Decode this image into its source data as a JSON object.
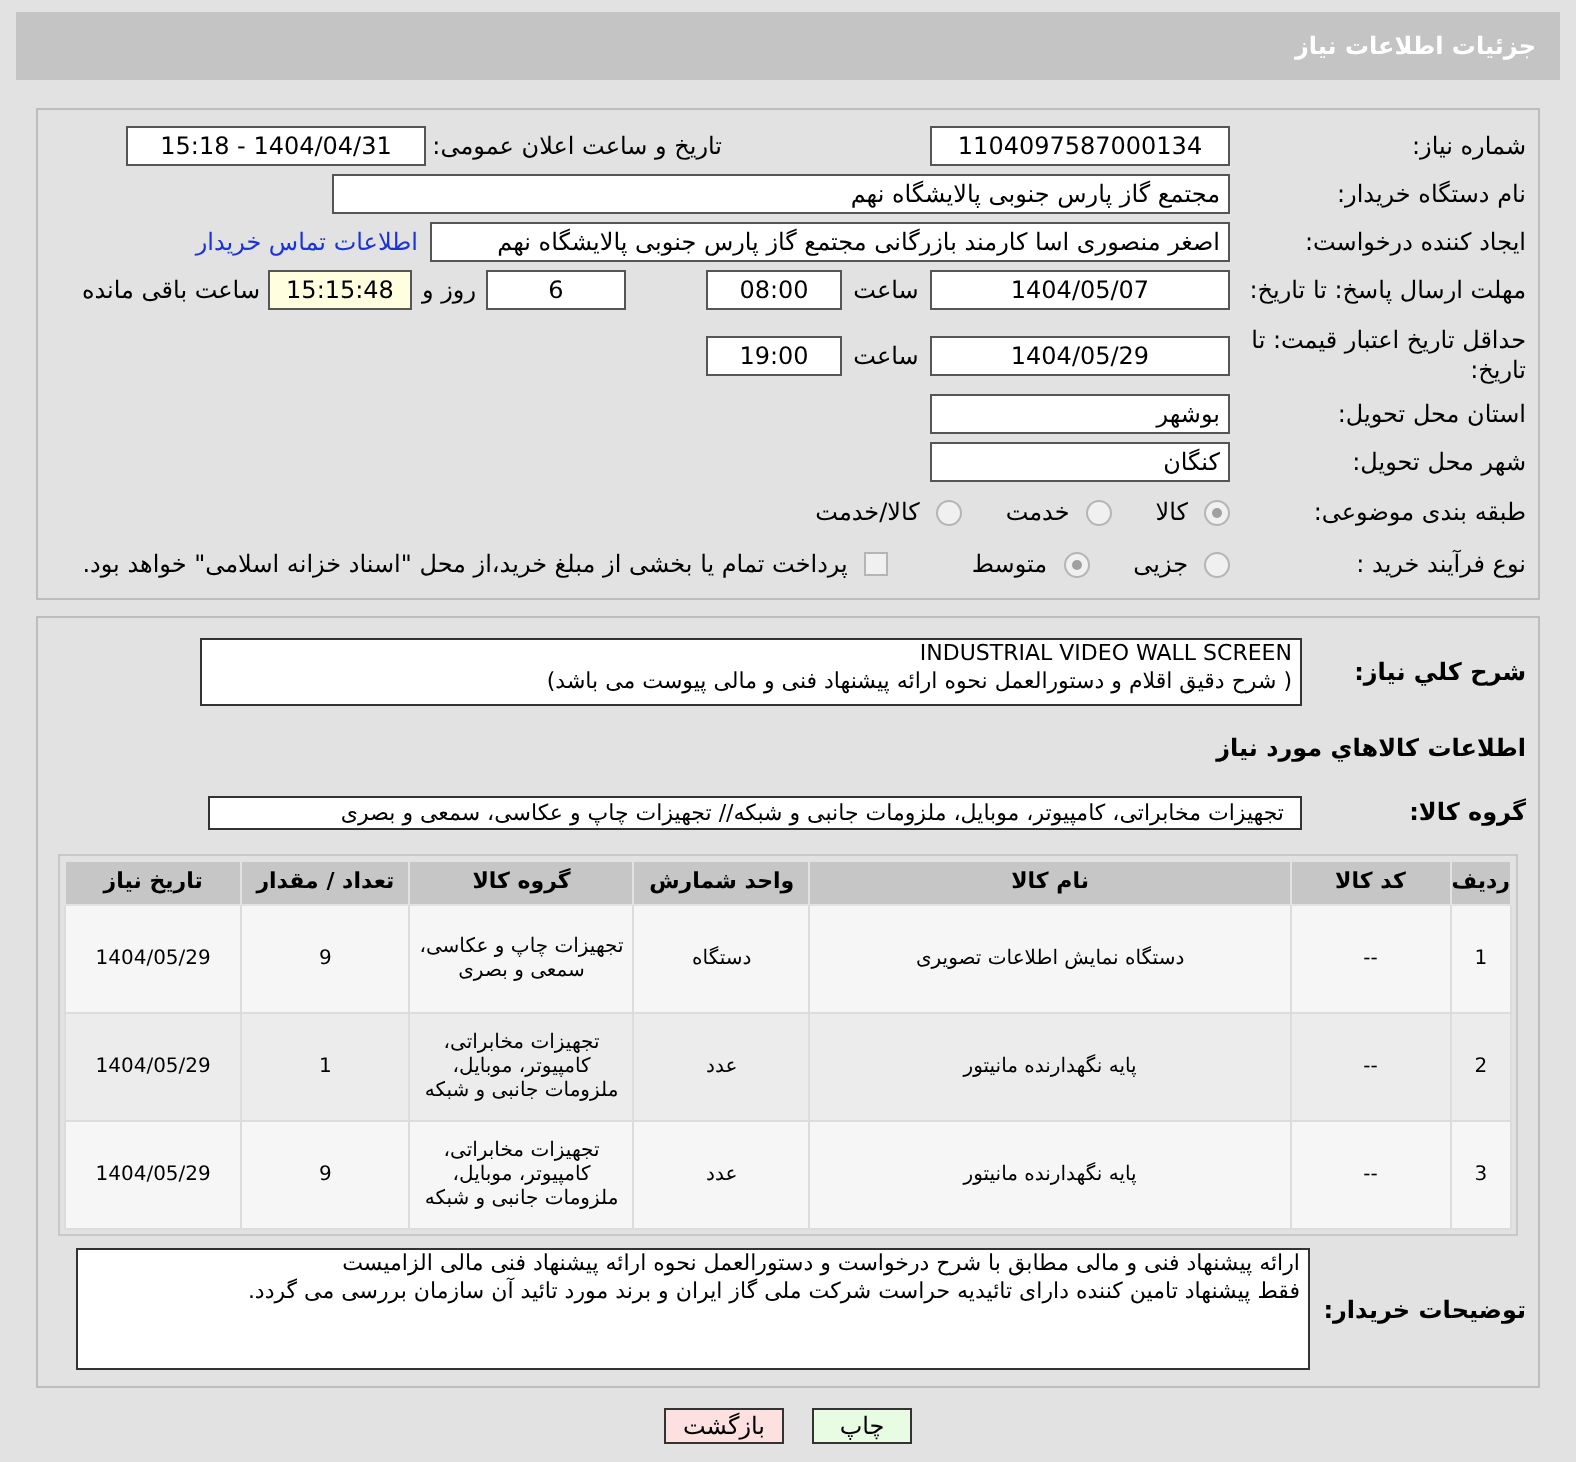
{
  "page": {
    "title": "جزئیات اطلاعات نیاز"
  },
  "need_number": {
    "label": "شماره نیاز:",
    "value": "1104097587000134"
  },
  "announce": {
    "label": "تاریخ و ساعت اعلان عمومی:",
    "value": "1404/04/31 - 15:18"
  },
  "buyer_org": {
    "label": "نام دستگاه خریدار:",
    "value": "مجتمع گاز پارس جنوبی  پالایشگاه نهم"
  },
  "requester": {
    "label": "ایجاد کننده درخواست:",
    "value": "اصغر منصوری اسا کارمند بازرگانی مجتمع گاز پارس جنوبی  پالایشگاه نهم",
    "link": "اطلاعات تماس خریدار"
  },
  "deadline": {
    "label": "مهلت ارسال پاسخ: تا تاریخ:",
    "date": "1404/05/07",
    "time_label": "ساعت",
    "time": "08:00",
    "days": "6",
    "days_label": "روز و",
    "remaining": "15:15:48",
    "remaining_label": "ساعت باقی مانده"
  },
  "validity": {
    "label": "حداقل تاریخ اعتبار قیمت: تا تاریخ:",
    "date": "1404/05/29",
    "time_label": "ساعت",
    "time": "19:00"
  },
  "province": {
    "label": "استان محل تحویل:",
    "value": "بوشهر"
  },
  "city": {
    "label": "شهر محل تحویل:",
    "value": "کنگان"
  },
  "category": {
    "label": "طبقه بندی موضوعی:",
    "options": [
      {
        "label": "کالا",
        "selected": true
      },
      {
        "label": "خدمت",
        "selected": false
      },
      {
        "label": "کالا/خدمت",
        "selected": false
      }
    ]
  },
  "process": {
    "label": "نوع فرآیند خرید :",
    "options": [
      {
        "label": "جزیی",
        "selected": false
      },
      {
        "label": "متوسط",
        "selected": true
      }
    ],
    "treasury": {
      "label": "پرداخت تمام یا بخشی از مبلغ خرید،از محل \"اسناد خزانه اسلامی\" خواهد بود.",
      "checked": false
    }
  },
  "description": {
    "label": "شرح کلي نیاز:",
    "lines": [
      "INDUSTRIAL VIDEO WALL SCREEN",
      "( شرح دقیق اقلام و دستورالعمل نحوه ارائه پیشنهاد فنی و مالی پیوست می باشد)"
    ]
  },
  "goods_title": "اطلاعات کالاهاي مورد نیاز",
  "goods_group": {
    "label": "گروه کالا:",
    "value": "تجهیزات مخابراتی، کامپیوتر، موبایل، ملزومات جانبی و شبکه// تجهیزات چاپ و عکاسی، سمعی و بصری"
  },
  "table": {
    "columns": [
      "ردیف",
      "کد کالا",
      "نام کالا",
      "واحد شمارش",
      "گروه کالا",
      "تعداد / مقدار",
      "تاریخ نیاز"
    ],
    "rows": [
      [
        "1",
        "--",
        "دستگاه نمایش اطلاعات تصویری",
        "دستگاه",
        "تجهیزات چاپ و عکاسی، سمعی و بصری",
        "9",
        "1404/05/29"
      ],
      [
        "2",
        "--",
        "پایه نگهدارنده مانیتور",
        "عدد",
        "تجهیزات مخابراتی، کامپیوتر، موبایل، ملزومات جانبی و شبکه",
        "1",
        "1404/05/29"
      ],
      [
        "3",
        "--",
        "پایه نگهدارنده مانیتور",
        "عدد",
        "تجهیزات مخابراتی، کامپیوتر، موبایل، ملزومات جانبی و شبکه",
        "9",
        "1404/05/29"
      ]
    ]
  },
  "buyer_notes": {
    "label": "توضیحات خریدار:",
    "lines": [
      "ارائه پیشنهاد فنی و مالی مطابق با شرح درخواست و دستورالعمل نحوه ارائه پیشنهاد فنی مالی الزامیست",
      "فقط پیشنهاد تامین کننده دارای تائیدیه حراست شرکت ملی گاز ایران و برند مورد تائید آن سازمان بررسی می گردد."
    ]
  },
  "buttons": [
    {
      "label": "چاپ",
      "kind": "print"
    },
    {
      "label": "بازگشت",
      "kind": "back"
    }
  ]
}
